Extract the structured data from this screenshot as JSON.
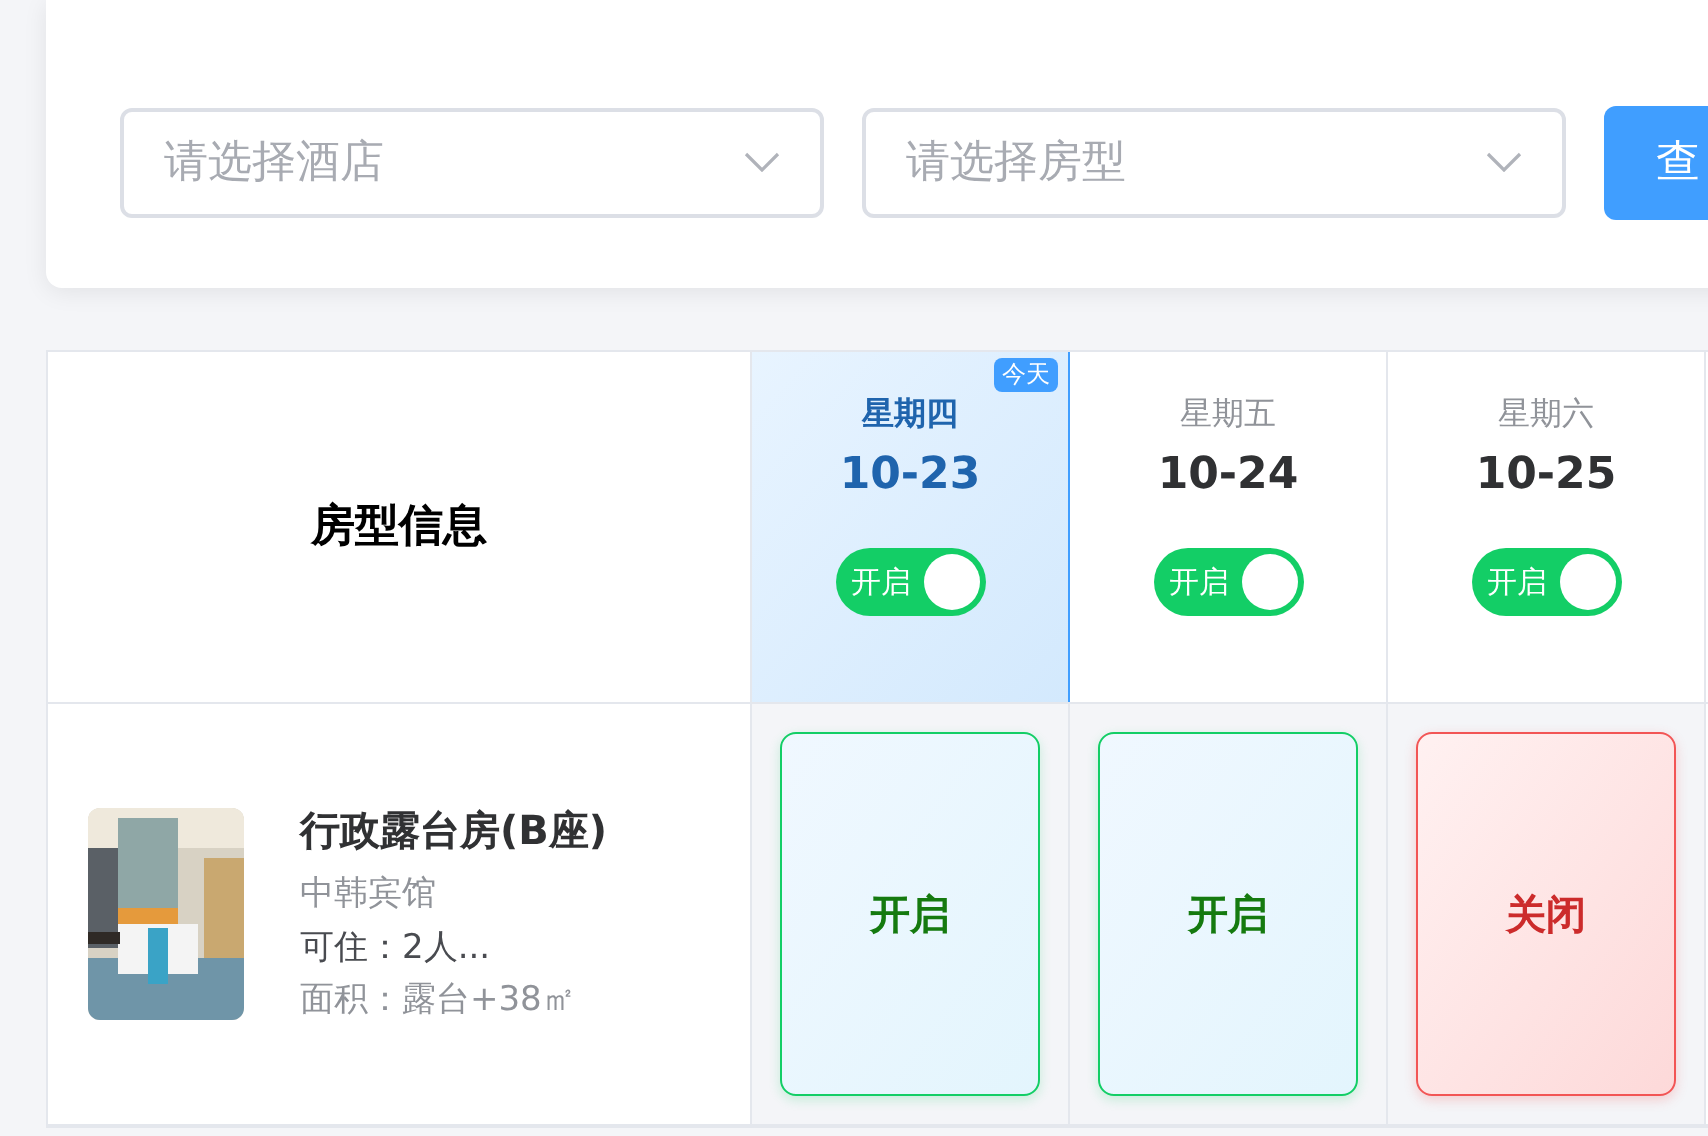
{
  "filters": [
    {
      "placeholder": "请选择酒店"
    },
    {
      "placeholder": "请选择房型"
    }
  ],
  "query_button": {
    "label": "查"
  },
  "table": {
    "header_title": "房型信息",
    "days": [
      {
        "weekday": "星期四",
        "date": "10-23",
        "selected": true,
        "badge": "今天",
        "switch": {
          "label": "开启",
          "on": true
        }
      },
      {
        "weekday": "星期五",
        "date": "10-24",
        "selected": false,
        "switch": {
          "label": "开启",
          "on": true
        }
      },
      {
        "weekday": "星期六",
        "date": "10-25",
        "selected": false,
        "switch": {
          "label": "开启",
          "on": true
        }
      }
    ],
    "rows": [
      {
        "room": {
          "kind": "picture",
          "name": "行政露台房(B座)",
          "hotel": "中韩宾馆",
          "capacity": "可住：2人...",
          "area": "面积：露台+38㎡"
        },
        "cells": [
          {
            "kind": "open",
            "label": "开启"
          },
          {
            "kind": "open",
            "label": "开启"
          },
          {
            "kind": "closed",
            "label": "关闭"
          }
        ]
      }
    ]
  }
}
